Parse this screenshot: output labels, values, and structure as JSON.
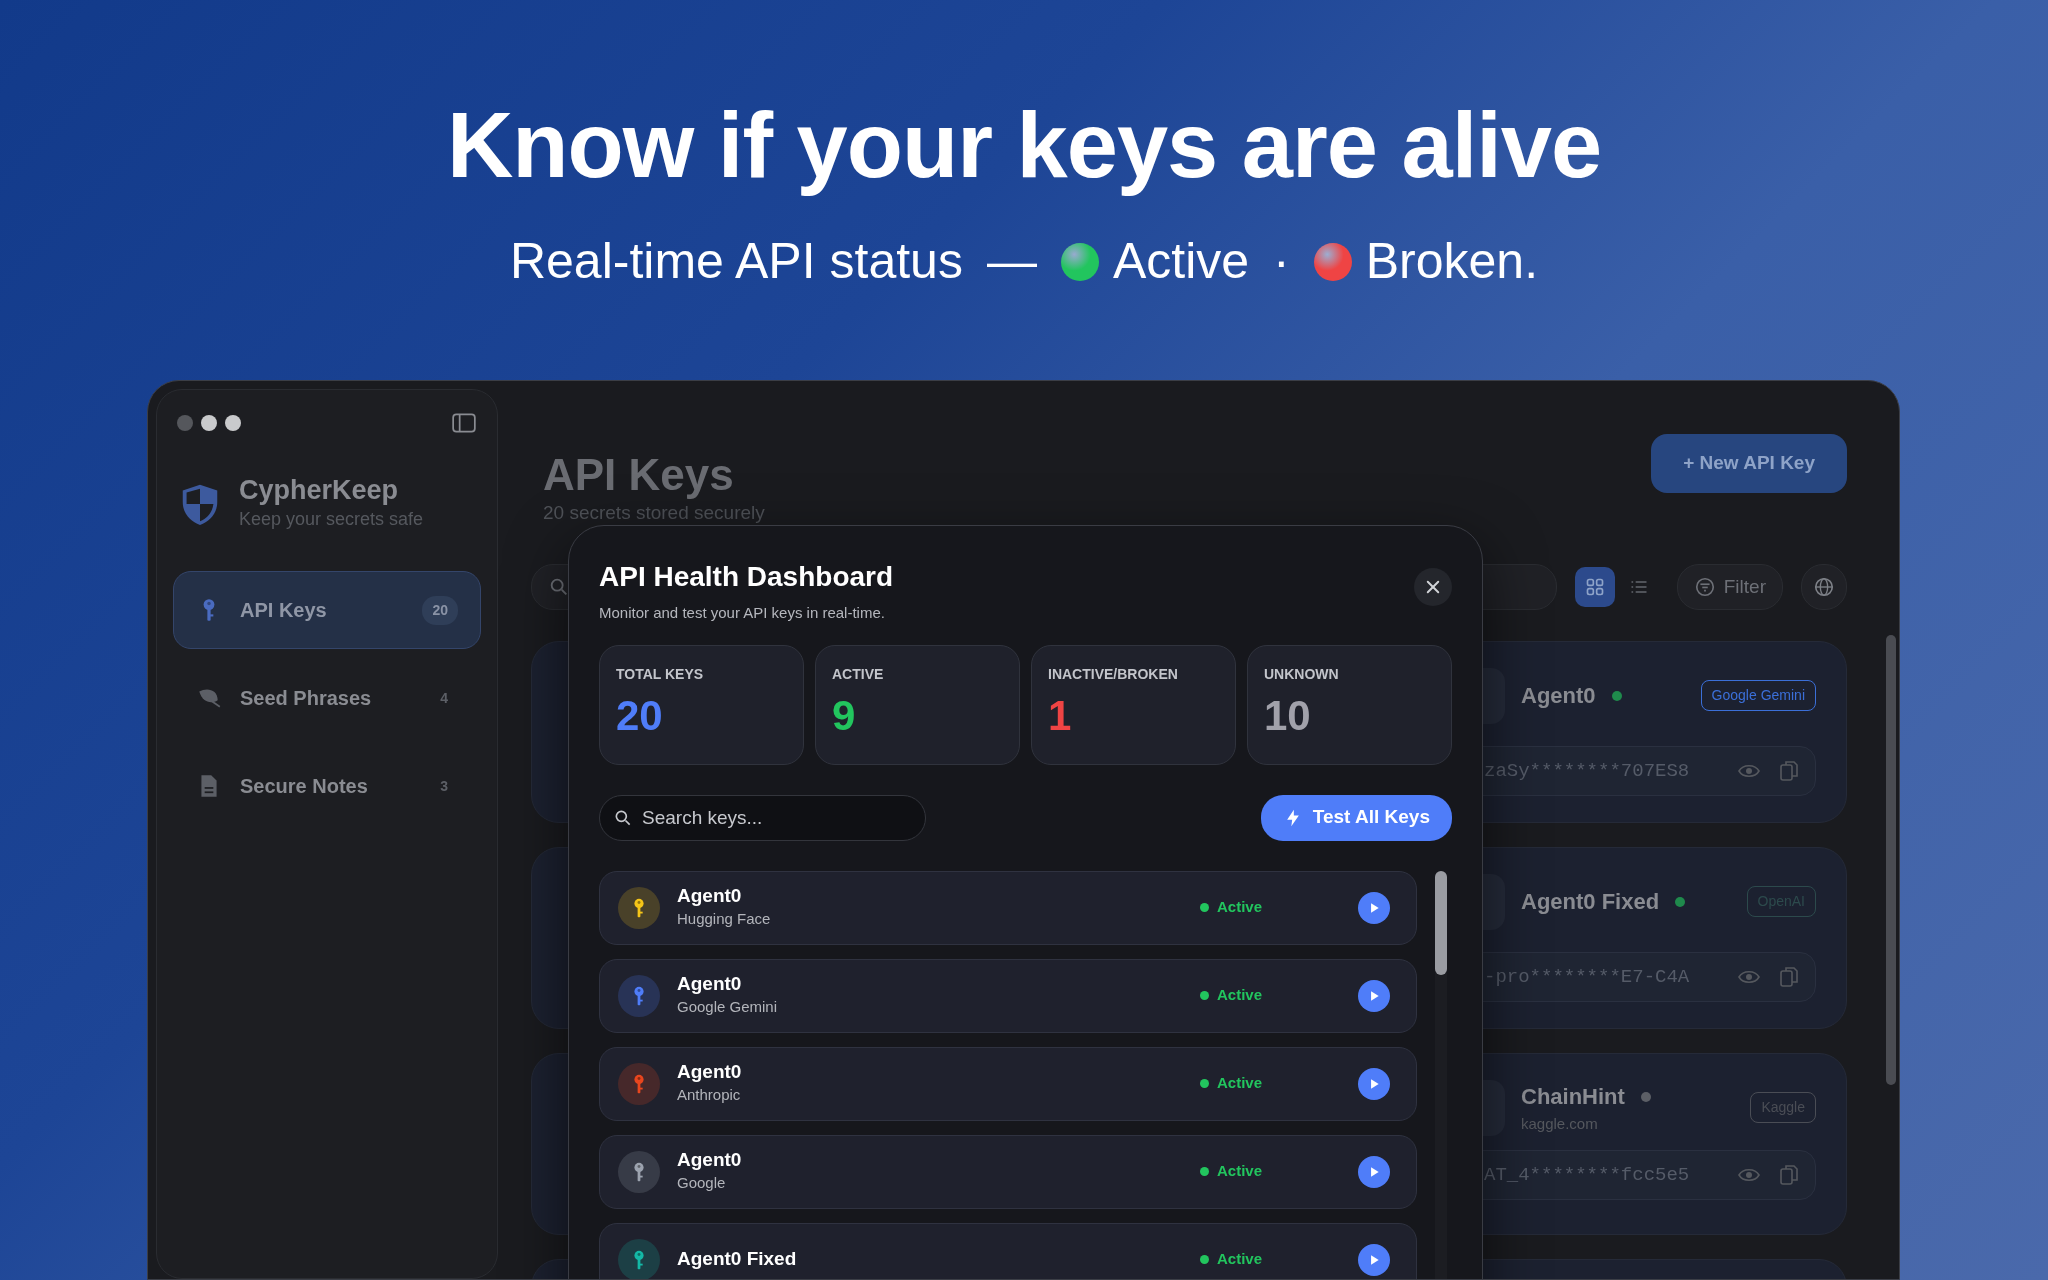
{
  "headline": "Know if your keys are alive",
  "subtitle": {
    "prefix": "Real-time API status",
    "dash": "—",
    "separator": "·",
    "legend": [
      {
        "label": "Active",
        "color": "#22c55e"
      },
      {
        "label": "Broken.",
        "color": "#ef4444"
      }
    ]
  },
  "sidebar": {
    "app_name": "CypherKeep",
    "tagline": "Keep your secrets safe",
    "items": [
      {
        "kind": "key",
        "label": "API Keys",
        "count": "20",
        "selected": true
      },
      {
        "kind": "leaf",
        "label": "Seed Phrases",
        "count": "4",
        "selected": false
      },
      {
        "kind": "document",
        "label": "Secure Notes",
        "count": "3",
        "selected": false
      }
    ]
  },
  "main": {
    "title": "API Keys",
    "subtitle": "20 secrets stored securely",
    "new_button": "+ New API Key",
    "filter_button": "Filter",
    "view_toggle": [
      {
        "kind": "grid",
        "selected": true
      },
      {
        "kind": "list",
        "selected": false
      }
    ],
    "cards": [
      {
        "name": "Agent0",
        "kind": "active",
        "tag": {
          "label": "Google Gemini",
          "color": "#3b6fd8"
        },
        "masked_key": "zaSy********707ES8"
      },
      {
        "name": "Agent0 Fixed",
        "kind": "active",
        "tag": {
          "label": "OpenAI",
          "color": "#2c4a4c"
        },
        "masked_key": "-pro********E7-C4A"
      },
      {
        "name": "ChainHint",
        "kind": "unknown",
        "tag": {
          "label": "Kaggle",
          "color": "#4a4d55"
        },
        "site": "kaggle.com",
        "masked_key": "AT_4********fcc5e5"
      }
    ]
  },
  "dialog": {
    "title": "API Health Dashboard",
    "subtitle": "Monitor and test your API keys in real-time.",
    "stats": [
      {
        "label": "TOTAL KEYS",
        "value": "20",
        "color": "#4f7df9"
      },
      {
        "label": "ACTIVE",
        "value": "9",
        "color": "#22c55e"
      },
      {
        "label": "INACTIVE/BROKEN",
        "value": "1",
        "color": "#ef4444"
      },
      {
        "label": "UNKNOWN",
        "value": "10",
        "color": "#a1a1aa"
      }
    ],
    "search": {
      "placeholder": "Search keys..."
    },
    "test_button": "Test All Keys",
    "keys": [
      {
        "name": "Agent0",
        "provider": "Hugging Face",
        "color": "#f5c518",
        "status": {
          "kind": "active",
          "label": "Active"
        }
      },
      {
        "name": "Agent0",
        "provider": "Google Gemini",
        "color": "#4f7df9",
        "status": {
          "kind": "active",
          "label": "Active"
        }
      },
      {
        "name": "Agent0",
        "provider": "Anthropic",
        "color": "#e8461e",
        "status": {
          "kind": "active",
          "label": "Active"
        }
      },
      {
        "name": "Agent0",
        "provider": "Google",
        "color": "#9ca3af",
        "status": {
          "kind": "active",
          "label": "Active"
        }
      },
      {
        "name": "Agent0 Fixed",
        "color": "#14b8a6",
        "status": {
          "kind": "active",
          "label": "Active"
        }
      }
    ]
  }
}
